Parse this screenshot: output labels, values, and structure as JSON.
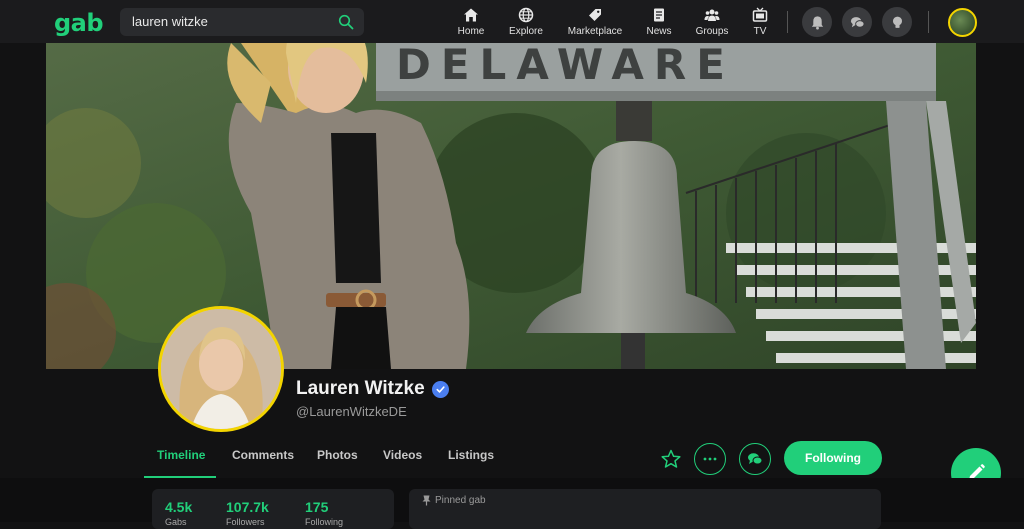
{
  "app": {
    "logo": "gab"
  },
  "search": {
    "value": "lauren witzke"
  },
  "nav": {
    "home": "Home",
    "explore": "Explore",
    "marketplace": "Marketplace",
    "news": "News",
    "groups": "Groups",
    "tv": "TV"
  },
  "profile": {
    "name": "Lauren Witzke",
    "handle": "@LaurenWitzkeDE",
    "banner_sign": "DELAWARE"
  },
  "tabs": [
    "Timeline",
    "Comments",
    "Photos",
    "Videos",
    "Listings"
  ],
  "actions": {
    "following": "Following"
  },
  "stats": [
    {
      "value": "4.5k",
      "label": "Gabs"
    },
    {
      "value": "107.7k",
      "label": "Followers"
    },
    {
      "value": "175",
      "label": "Following"
    }
  ],
  "pinned": {
    "label": "Pinned gab"
  },
  "colors": {
    "accent": "#21cf7a",
    "verified": "#4a7ef0",
    "avatar_ring": "#f3d400"
  }
}
